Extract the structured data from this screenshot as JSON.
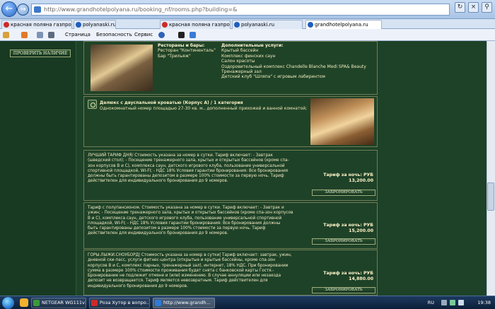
{
  "browser": {
    "url": "http://www.grandhotelpolyana.ru/booking_nf/rooms.php?building=&",
    "tabs": [
      {
        "label": "красная поляна газпром — Я..."
      },
      {
        "label": "красная поляна газпром — Я..."
      },
      {
        "label": "polyanaski.ru"
      },
      {
        "label": "polyanaski.ru"
      },
      {
        "label": "grandhotelpolyana.ru"
      }
    ],
    "commands": {
      "page": "Страница",
      "security": "Безопасность",
      "service": "Сервис"
    }
  },
  "sidebar": {
    "check_button": "ПРОВЕРИТЬ НАЛИЧИЕ"
  },
  "hotel_info": {
    "restaurants_title": "Рестораны и бары:",
    "restaurants": [
      "Ресторан \"Континенталь\"",
      "Бар \"Трильяж\""
    ],
    "services_title": "Дополнительные услуги:",
    "services": [
      "Крытый бассейн",
      "Комплекс финских саун",
      "Салон красоты",
      "Оздоровительный комплекс Chandelle Blanche Medi SPA& Beauty",
      "Тренажерный зал",
      "Детский клуб \"Шляпа\" с игровым лабиринтом"
    ]
  },
  "room": {
    "title": "Делюкс с двуспальной кроватью (Корпус А) / 1 категория",
    "description": "Однокомнатный номер площадью 27-30 кв. м., дополненный прихожей и ванной комнатой;"
  },
  "tariffs": [
    {
      "lines": [
        "ЛУЧШИЙ ТАРИФ ДНЯ/ Стоимость указана за номер в сутки. Тариф включает: - Завтрак",
        "(шведский стол); - Посещение тренажерного зала, крытых и открытых бассейнов (кроме спа-",
        "зон корпусов В и С), комплекса саун, детского игрового клуба, пользование универсальной",
        "спортивной площадкой, WI-FI; - НДС 18% Условия гарантии бронирования: Все бронирования",
        "должны быть гарантированы депозитом в размере 100% стоимости за первую ночь. Тариф",
        "действителен для индивидуального бронирования до 9 номеров."
      ],
      "price_label": "Тариф за ночь: РУБ",
      "price": "13,200.00",
      "book": "ЗАБРОНИРОВАТЬ"
    },
    {
      "lines": [
        "Тариф с полупансионом. Стоимость указана за номер в сутки. Тариф включает: - Завтрак и",
        "ужин; - Посещение тренажерного зала, крытых и открытых бассейнов (кроме спа-зон корпусов",
        "В и С), комплекса саун, детского игрового клуба, пользование универсальной спортивной",
        "площадкой, WI-FI; - НДС 18% Условия гарантии бронирования: Все бронирования должны",
        "быть гарантированы депозитом в размере 100% стоимости за первую ночь. Тариф",
        "действителен для индивидуального бронирования до 9 номеров."
      ],
      "price_label": "Тариф за ночь: РУБ",
      "price": "15,200.00",
      "book": "ЗАБРОНИРОВАТЬ"
    },
    {
      "lines": [
        "ГОРЫ.ЛЫЖИ.СНОУБОРД| Стоимость указана за номер в сутки| Тариф включает: завтрак, ужин,",
        "дневной ски-пасс, услуги фитнес-центра (открытые и крытые бассейны, кроме спа-зон",
        "корпусов В и С, комплекс парных, тренажерный зал), интернет, 18% НДС. При бронировании",
        "сумма в размере 100% стоимости проживания будет снята с банковской карты Гостя.-",
        "Бронирование не подлежит отмене и (или) изменению. В случае аннуляции или незаезда",
        "депозит не возвращается. Тариф является невозвратным. Тариф действителен для",
        "индивидуального бронирования до 9 номеров."
      ],
      "price_label": "Тариф за ночь: РУБ",
      "price": "14,880.00",
      "book": "ЗАБРОНИРОВАТЬ"
    }
  ],
  "taskbar": {
    "buttons": [
      {
        "label": "NETGEAR WG111v3 ..."
      },
      {
        "label": "Роза Хутор в вопро..."
      },
      {
        "label": "http://www.grandh..."
      }
    ],
    "lang": "RU",
    "time": "19:38"
  },
  "colors": {
    "page_bg": "#1e4228",
    "accent_text": "#f2ebbd",
    "border": "#6f7e55"
  }
}
